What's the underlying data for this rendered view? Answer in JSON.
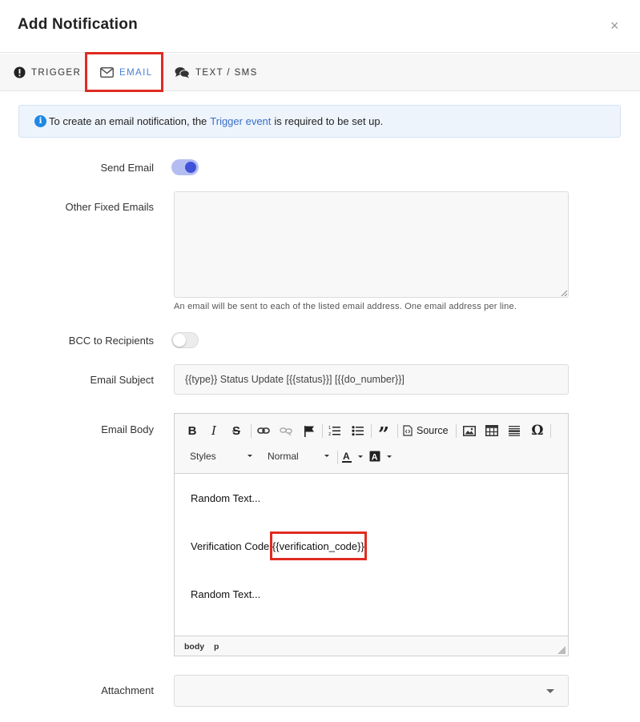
{
  "modal": {
    "title": "Add Notification",
    "close_label": "×"
  },
  "tabs": [
    {
      "label": "TRIGGER",
      "icon": "exclamation-circle-icon"
    },
    {
      "label": "EMAIL",
      "icon": "envelope-icon",
      "active": true
    },
    {
      "label": "TEXT / SMS",
      "icon": "comments-icon"
    }
  ],
  "alert": {
    "before": "To create an email notification, the",
    "link": "Trigger event",
    "after": "is required to be set up."
  },
  "form": {
    "send_email": {
      "label": "Send Email",
      "checked": true
    },
    "other_emails": {
      "label": "Other Fixed Emails",
      "value": "",
      "help": "An email will be sent to each of the listed email address. One email address per line."
    },
    "bcc": {
      "label": "BCC to Recipients",
      "checked": false
    },
    "subject": {
      "label": "Email Subject",
      "value": "{{type}} Status Update [{{status}}] [{{do_number}}]"
    },
    "body": {
      "label": "Email Body",
      "toolbar": {
        "source_label": "Source",
        "styles_label": "Styles",
        "format_label": "Normal"
      },
      "content": {
        "line1": "Random Text...",
        "line2_prefix": "Verification Code",
        "line2_code": "{{verification_code}}",
        "line3": "Random Text..."
      },
      "path": [
        "body",
        "p"
      ]
    },
    "attachment": {
      "label": "Attachment",
      "value": ""
    }
  },
  "colors": {
    "accent": "#4a7fd3",
    "toggle_on": "#4152d9",
    "highlight": "#e02b20",
    "info": "#1e88e5"
  }
}
